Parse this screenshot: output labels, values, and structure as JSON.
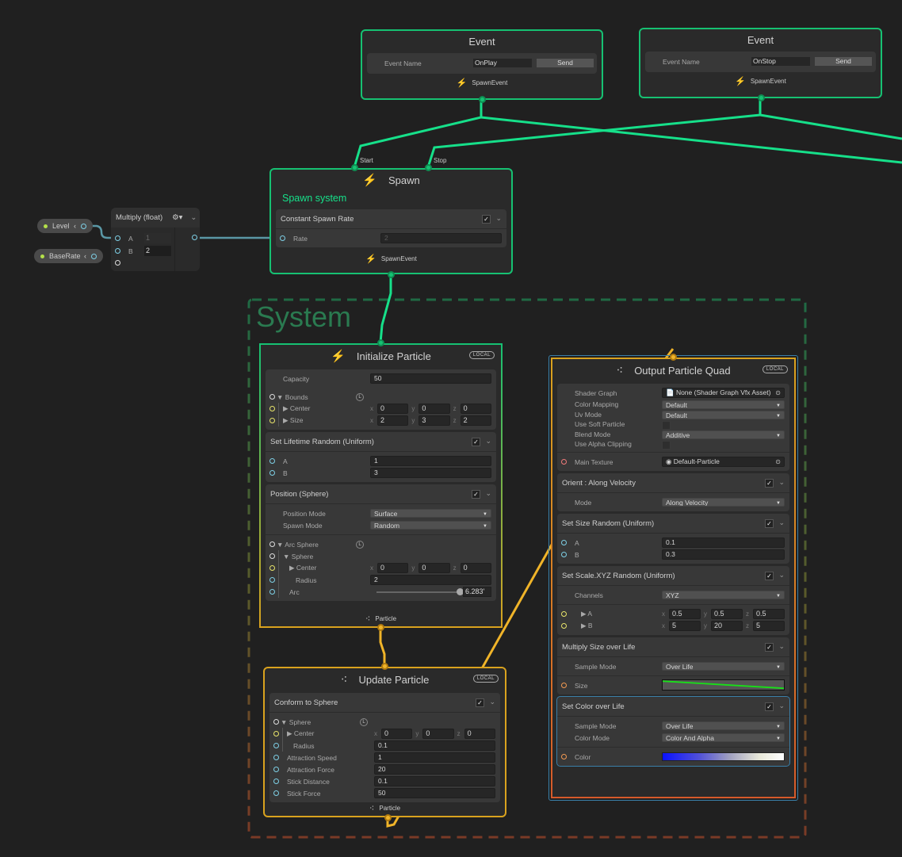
{
  "colors": {
    "flow": "#16c172",
    "context_orange": "#d9a21e",
    "data_wire": "#5a97a5",
    "system_label": "#1f5a3c"
  },
  "events": [
    {
      "title": "Event",
      "field_label": "Event Name",
      "value": "OnPlay",
      "button": "Send",
      "output": "SpawnEvent"
    },
    {
      "title": "Event",
      "field_label": "Event Name",
      "value": "OnStop",
      "button": "Send",
      "output": "SpawnEvent"
    }
  ],
  "parameters": [
    {
      "name": "Level"
    },
    {
      "name": "BaseRate"
    }
  ],
  "multiply": {
    "title": "Multiply (float)",
    "inputs": [
      {
        "label": "A",
        "value": "1"
      },
      {
        "label": "B",
        "value": "2"
      }
    ]
  },
  "spawn": {
    "title": "Spawn",
    "subtitle": "Spawn system",
    "inputs": [
      "Start",
      "Stop"
    ],
    "output": "SpawnEvent",
    "blocks": [
      {
        "title": "Constant Spawn Rate",
        "checked": true,
        "sections": [
          [
            {
              "type": "field",
              "port": "c",
              "label": "Rate",
              "value": "2"
            }
          ]
        ]
      }
    ]
  },
  "system": {
    "label": "System"
  },
  "initialize": {
    "title": "Initialize Particle",
    "badge": "LOCAL",
    "output": "Particle",
    "blocks": [
      {
        "sections": [
          [
            {
              "type": "field",
              "label": "Capacity",
              "value": "50"
            },
            {
              "type": "spacer"
            },
            {
              "type": "group",
              "port": "w",
              "label": "▼ Bounds",
              "space": "L"
            },
            {
              "type": "vec",
              "port": "y",
              "label": "▶ Center",
              "indent": 1,
              "values": [
                "0",
                "0",
                "0"
              ]
            },
            {
              "type": "vec",
              "port": "y",
              "label": "▶ Size",
              "indent": 1,
              "values": [
                "2",
                "3",
                "2"
              ]
            }
          ]
        ]
      },
      {
        "title": "Set Lifetime Random (Uniform)",
        "checked": true,
        "sections": [
          [
            {
              "type": "field",
              "port": "c",
              "label": "A",
              "value": "1"
            },
            {
              "type": "field",
              "port": "c",
              "label": "B",
              "value": "3"
            }
          ]
        ]
      },
      {
        "title": "Position (Sphere)",
        "checked": true,
        "sections": [
          [
            {
              "type": "dropdown",
              "label": "Position Mode",
              "value": "Surface"
            },
            {
              "type": "dropdown",
              "label": "Spawn Mode",
              "value": "Random"
            }
          ],
          [
            {
              "type": "group",
              "port": "w",
              "label": "▼ Arc Sphere",
              "space": "L"
            },
            {
              "type": "group",
              "port": "w",
              "label": "▼ Sphere",
              "indent": 1
            },
            {
              "type": "vec",
              "port": "y",
              "label": "▶ Center",
              "indent": 2,
              "values": [
                "0",
                "0",
                "0"
              ]
            },
            {
              "type": "field",
              "port": "c",
              "label": "Radius",
              "indent": 2,
              "value": "2"
            },
            {
              "type": "slider",
              "port": "c",
              "label": "Arc",
              "indent": 1,
              "value": "6.283'",
              "fraction": 1.0
            }
          ]
        ]
      }
    ]
  },
  "update": {
    "title": "Update Particle",
    "badge": "LOCAL",
    "output": "Particle",
    "blocks": [
      {
        "title": "Conform to Sphere",
        "checked": true,
        "sections": [
          [
            {
              "type": "group",
              "port": "w",
              "label": "▼ Sphere",
              "space": "L"
            },
            {
              "type": "vec",
              "port": "y",
              "label": "▶ Center",
              "indent": 1,
              "values": [
                "0",
                "0",
                "0"
              ]
            },
            {
              "type": "field",
              "port": "c",
              "label": "Radius",
              "indent": 1,
              "value": "0.1"
            },
            {
              "type": "field",
              "port": "c",
              "label": "Attraction Speed",
              "value": "1"
            },
            {
              "type": "field",
              "port": "c",
              "label": "Attraction Force",
              "value": "20"
            },
            {
              "type": "field",
              "port": "c",
              "label": "Stick Distance",
              "value": "0.1"
            },
            {
              "type": "field",
              "port": "c",
              "label": "Stick Force",
              "value": "50"
            }
          ]
        ]
      }
    ]
  },
  "output": {
    "title": "Output Particle Quad",
    "badge": "LOCAL",
    "blocks": [
      {
        "sections": [
          [
            {
              "type": "object",
              "label": "Shader Graph",
              "value": "📄 None (Shader Graph Vfx Asset)"
            },
            {
              "type": "dropdown",
              "label": "Color Mapping",
              "value": "Default",
              "h": 13
            },
            {
              "type": "dropdown",
              "label": "Uv Mode",
              "value": "Default",
              "h": 13
            },
            {
              "type": "checkbox",
              "label": "Use Soft Particle",
              "h": 12
            },
            {
              "type": "dropdown",
              "label": "Blend Mode",
              "value": "Additive",
              "h": 13
            },
            {
              "type": "checkbox",
              "label": "Use Alpha Clipping",
              "h": 12
            }
          ],
          [
            {
              "type": "object",
              "port": "r",
              "label": "Main Texture",
              "value": "◉ Default-Particle"
            }
          ]
        ]
      },
      {
        "title": "Orient : Along Velocity",
        "checked": true,
        "sections": [
          [
            {
              "type": "dropdown",
              "label": "Mode",
              "value": "Along Velocity"
            }
          ]
        ]
      },
      {
        "title": "Set Size Random (Uniform)",
        "checked": true,
        "sections": [
          [
            {
              "type": "field",
              "port": "c",
              "label": "A",
              "value": "0.1"
            },
            {
              "type": "field",
              "port": "c",
              "label": "B",
              "value": "0.3"
            }
          ]
        ]
      },
      {
        "title": "Set Scale.XYZ Random (Uniform)",
        "checked": true,
        "sections": [
          [
            {
              "type": "dropdown",
              "label": "Channels",
              "value": "XYZ"
            }
          ],
          [
            {
              "type": "vec",
              "port": "y",
              "label": "▶ A",
              "tight": 1,
              "values": [
                "0.5",
                "0.5",
                "0.5"
              ]
            },
            {
              "type": "vec",
              "port": "y",
              "label": "▶ B",
              "tight": 1,
              "values": [
                "5",
                "20",
                "5"
              ]
            }
          ]
        ]
      },
      {
        "title": "Multiply Size over Life",
        "checked": true,
        "sections": [
          [
            {
              "type": "dropdown",
              "label": "Sample Mode",
              "value": "Over Life"
            }
          ],
          [
            {
              "type": "curve",
              "port": "o",
              "label": "Size",
              "curve": [
                1.0,
                0.55
              ]
            }
          ]
        ]
      },
      {
        "title": "Set Color over Life",
        "checked": true,
        "selected": true,
        "sections": [
          [
            {
              "type": "dropdown",
              "label": "Sample Mode",
              "value": "Over Life"
            },
            {
              "type": "dropdown",
              "label": "Color Mode",
              "value": "Color And Alpha"
            }
          ],
          [
            {
              "type": "gradient",
              "port": "o",
              "label": "Color",
              "gradient": [
                "#0a12ff",
                "#ffffff"
              ]
            }
          ]
        ]
      }
    ]
  }
}
